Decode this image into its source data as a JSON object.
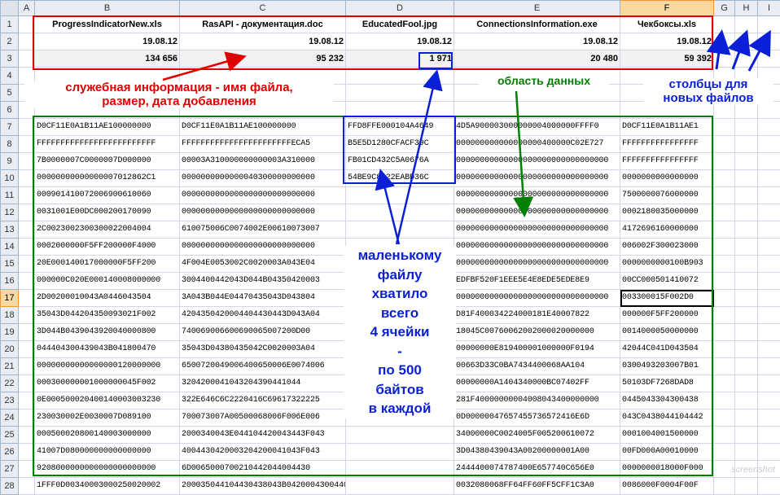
{
  "columns": [
    "A",
    "B",
    "C",
    "D",
    "E",
    "F",
    "G",
    "H",
    "I"
  ],
  "selected_column": "F",
  "selected_row": 17,
  "rows": [
    {
      "n": 1,
      "cells": [
        "",
        "ProgressIndicatorNew.xls",
        "RasAPI - документация.doc",
        "EducatedFool.jpg",
        "ConnectionsInformation.exe",
        "Чекбоксы.xls",
        "",
        "",
        ""
      ]
    },
    {
      "n": 2,
      "cells": [
        "",
        "19.08.12",
        "19.08.12",
        "19.08.12",
        "19.08.12",
        "19.08.12",
        "",
        "",
        ""
      ]
    },
    {
      "n": 3,
      "cells": [
        "",
        "134 656",
        "95 232",
        "1 971",
        "20 480",
        "59 392",
        "",
        "",
        ""
      ]
    },
    {
      "n": 4,
      "cells": [
        "",
        "",
        "",
        "",
        "",
        "",
        "",
        "",
        ""
      ]
    },
    {
      "n": 5,
      "cells": [
        "",
        "",
        "",
        "",
        "",
        "",
        "",
        "",
        ""
      ]
    },
    {
      "n": 6,
      "cells": [
        "",
        "",
        "",
        "",
        "",
        "",
        "",
        "",
        ""
      ]
    },
    {
      "n": 7,
      "cells": [
        "",
        "D0CF11E0A1B11AE100000000",
        "D0CF11E0A1B11AE100000000",
        "FFD8FFE000104A4649",
        "4D5A900003000000004000000FFFF0",
        "D0CF11E0A1B11AE1",
        "",
        "",
        ""
      ]
    },
    {
      "n": 8,
      "cells": [
        "",
        "FFFFFFFFFFFFFFFFFFFFFFFFF",
        "FFFFFFFFFFFFFFFFFFFFFFFECA5",
        "B5E5D1280CFACF39C",
        "000000000000000000400000C02E727",
        "FFFFFFFFFFFFFFFF",
        "",
        "",
        ""
      ]
    },
    {
      "n": 9,
      "cells": [
        "",
        "7B0000007C0000007D000000",
        "00003A310000000000003A310000",
        "FB01CD432C5A0676A",
        "00000000000000000000000000000000",
        "FFFFFFFFFFFFFFFF",
        "",
        "",
        ""
      ]
    },
    {
      "n": 10,
      "cells": [
        "",
        "00000000000000007012862C1",
        "0000000000000040300000000000",
        "54BE9C8A22EABD36C",
        "00000000000000000000000000000000",
        "0000000000000000",
        "",
        "",
        ""
      ]
    },
    {
      "n": 11,
      "cells": [
        "",
        "000901410072006900610060",
        "0000000000000000000000000000",
        "",
        "00000000000000000000000000000000",
        "7500000076000000",
        "",
        "",
        ""
      ]
    },
    {
      "n": 12,
      "cells": [
        "",
        "0031001E00DC000200170090",
        "0000000000000000000000000000",
        "",
        "00000000000000000000000000000000",
        "0002180035000000",
        "",
        "",
        ""
      ]
    },
    {
      "n": 13,
      "cells": [
        "",
        "2C0023002300300022004004",
        "610075006C0074002E00610073007",
        "",
        "00000000000000000000000000000000",
        "4172696160000000",
        "",
        "",
        ""
      ]
    },
    {
      "n": 14,
      "cells": [
        "",
        "0002000000F5FF200000F4000",
        "0000000000000000000000000000",
        "",
        "00000000000000000000000000000000",
        "006002F300023000",
        "",
        "",
        ""
      ]
    },
    {
      "n": 15,
      "cells": [
        "",
        "20E000140017000000F5FF200",
        "4F004E0053002C0020003A043E04",
        "",
        "00000000000000000000000000000000",
        "0000000000100B903",
        "",
        "",
        ""
      ]
    },
    {
      "n": 16,
      "cells": [
        "",
        "000000C020E000140008000000",
        "3004400442043D044B04350420003",
        "",
        "EDFBF520F1EEE5E4E8EDE5EDE8E9",
        "00CC000501410072",
        "",
        "",
        ""
      ]
    },
    {
      "n": 17,
      "cells": [
        "",
        "2D00200010043A0446043504",
        "3A043B044E04470435043D043804",
        "",
        "00000000000000000000000000000000",
        "003300015F002D0",
        "",
        "",
        ""
      ]
    },
    {
      "n": 18,
      "cells": [
        "",
        "35043D044204350093021F002",
        "4204350420004404430443D043A04",
        "",
        "D81F400034224000181E40007822",
        "000000F5FF200000",
        "",
        "",
        ""
      ]
    },
    {
      "n": 19,
      "cells": [
        "",
        "3D044B0439043920040000800",
        "740069006600690065007200D00",
        "",
        "18045C00760062002000020000000",
        "0014000050000000",
        "",
        "",
        ""
      ]
    },
    {
      "n": 20,
      "cells": [
        "",
        "044404300439043B041800470",
        "35043D04380435042C0020003A04",
        "",
        "00000000E819400001000000F0194",
        "42044C041D043504",
        "",
        "",
        ""
      ]
    },
    {
      "n": 21,
      "cells": [
        "",
        "00000000000000000120000000",
        "6500720049006400650006E0074006",
        "",
        "00663D33C0BA7434400068AA104",
        "0300493203007B01",
        "",
        "",
        ""
      ]
    },
    {
      "n": 22,
      "cells": [
        "",
        "000300000001000000045F002",
        "3204200041043204390441044",
        "",
        "00000000A1404340000BC07402FF",
        "50103DF7268DAD8",
        "",
        "",
        ""
      ]
    },
    {
      "n": 23,
      "cells": [
        "",
        "0E000500020400140003003230",
        "322E646C6C2220416C69617322225",
        "",
        "281F40000000004008043400000000",
        "0445043304300438",
        "",
        "",
        ""
      ]
    },
    {
      "n": 24,
      "cells": [
        "",
        "230030002E0030007D089100",
        "700073007A00500068006F006E006",
        "",
        "0D00000047657455736572416E6D",
        "043C0438044104442",
        "",
        "",
        ""
      ]
    },
    {
      "n": 25,
      "cells": [
        "",
        "000500020800140003000000",
        "2000340043E044104420043443F043",
        "",
        "34000000C0024005F005200610072",
        "0001004001500000",
        "",
        "",
        ""
      ]
    },
    {
      "n": 26,
      "cells": [
        "",
        "41007D080000000000000000",
        "4004430420003204200041043F043",
        "",
        "3D04380439043A00200000001A00",
        "00FD000A00010000",
        "",
        "",
        ""
      ]
    },
    {
      "n": 27,
      "cells": [
        "",
        "9208000000000000000000000",
        "6D0065000700210442044004430",
        "",
        "2444400074787400E657740C656E0",
        "0000000018000F000",
        "",
        "",
        ""
      ]
    },
    {
      "n": 28,
      "cells": [
        "",
        "1FFF0D00340003000250020002",
        "200035044104430438043B0420004300440",
        "",
        "0032080068FF64FF60FF5CFF1C3A0",
        "0086000F0004F00F",
        "",
        "",
        ""
      ]
    }
  ],
  "annotations": {
    "service_info": "служебная информация - имя файла,\nразмер, дата добавления",
    "data_area": "область данных",
    "new_columns": "столбцы для\nновых файлов",
    "small_file": "маленькому\nфайлу\nхватило\nвсего\n4 ячейки\n-\nпо 500\nбайтов\nв каждой"
  },
  "colors": {
    "red": "#e00000",
    "green": "#008000",
    "blue": "#0a1fd6",
    "selected_header": "#f9d99f"
  },
  "watermark": "screenshot"
}
